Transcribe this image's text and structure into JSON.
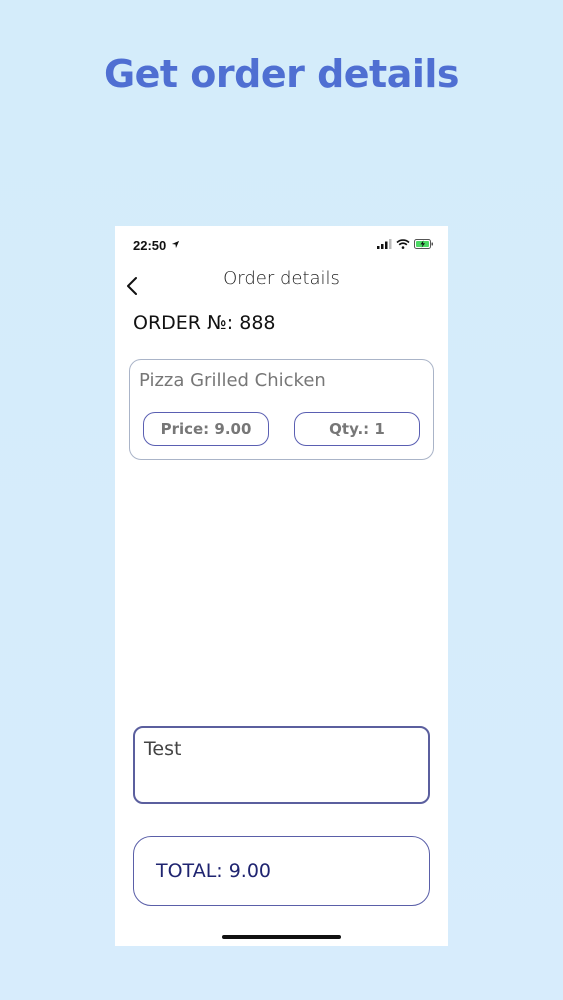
{
  "promo": {
    "headline": "Get order details"
  },
  "status_bar": {
    "time": "22:50",
    "icons": [
      "location-arrow-icon",
      "cellular-signal-icon",
      "wifi-icon",
      "battery-charging-icon"
    ]
  },
  "nav": {
    "title": "Order details",
    "back_icon": "chevron-left-icon"
  },
  "order": {
    "number_label": "ORDER №: 888",
    "items": [
      {
        "name": "Pizza Grilled Chicken",
        "price_label": "Price: 9.00",
        "qty_label": "Qty.: 1"
      }
    ],
    "comment": "Test",
    "total_label": "TOTAL: 9.00"
  },
  "colors": {
    "headline": "#4f6fd2",
    "background": "#d4ecfa",
    "pill_border": "#5a5fb2",
    "total_text": "#1f2470",
    "battery_charging": "#4cd964"
  }
}
